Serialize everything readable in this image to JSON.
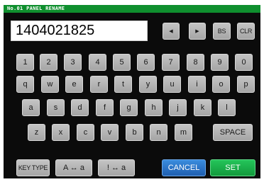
{
  "title": "No.01 PANEL RENAME",
  "input": {
    "value": "1404021825"
  },
  "nav": {
    "left_icon": "arrow-left-icon",
    "right_icon": "arrow-right-icon",
    "bs": "BS",
    "clr": "CLR"
  },
  "rows": {
    "r1": [
      "1",
      "2",
      "3",
      "4",
      "5",
      "6",
      "7",
      "8",
      "9",
      "0"
    ],
    "r2": [
      "q",
      "w",
      "e",
      "r",
      "t",
      "y",
      "u",
      "i",
      "o",
      "p"
    ],
    "r3": [
      "a",
      "s",
      "d",
      "f",
      "g",
      "h",
      "j",
      "k",
      "l"
    ],
    "r4": [
      "z",
      "x",
      "c",
      "v",
      "b",
      "n",
      "m"
    ]
  },
  "space": "SPACE",
  "bottom": {
    "key_type": "KEY TYPE",
    "case_toggle": "A ↔ a",
    "symbol_toggle": "! ↔ a",
    "cancel": "CANCEL",
    "set": "SET"
  },
  "colors": {
    "title_bar": "#0f8f2e",
    "panel": "#0b0b0b",
    "key": "#b5b5b5",
    "cancel": "#2a74c9",
    "set": "#1bb04a"
  }
}
